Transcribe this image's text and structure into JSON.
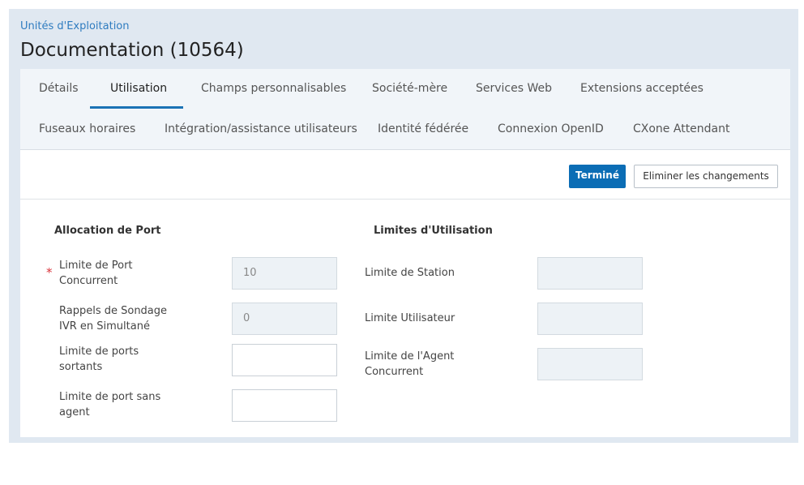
{
  "breadcrumb": "Unités d'Exploitation",
  "title": "Documentation (10564)",
  "tabs": {
    "details": "Détails",
    "usage": "Utilisation",
    "custom_fields": "Champs personnalisables",
    "parent_company": "Société-mère",
    "web_services": "Services Web",
    "accepted_extensions": "Extensions acceptées",
    "time_zones": "Fuseaux horaires",
    "integration": "Intégration/assistance utilisateurs",
    "federated_identity": "Identité fédérée",
    "openid": "Connexion OpenID",
    "cxone_attendant": "CXone Attendant",
    "active": "usage"
  },
  "actions": {
    "done": "Terminé",
    "discard": "Eliminer les changements"
  },
  "port_allocation": {
    "title": "Allocation de Port",
    "concurrent_port_limit": {
      "label_line1": "Limite de Port",
      "label_line2": "Concurrent",
      "value": "10",
      "required": "*"
    },
    "ivr_callbacks": {
      "label_line1": "Rappels de Sondage",
      "label_line2": "IVR en Simultané",
      "value": "0"
    },
    "outbound_ports": {
      "label_line1": "Limite de ports",
      "label_line2": "sortants",
      "value": ""
    },
    "agentless_ports": {
      "label_line1": "Limite de port sans",
      "label_line2": "agent",
      "value": ""
    }
  },
  "usage_limits": {
    "title": "Limites d'Utilisation",
    "station_limit": {
      "label": "Limite de Station",
      "value": ""
    },
    "user_limit": {
      "label": "Limite Utilisateur",
      "value": ""
    },
    "concurrent_agent_limit": {
      "label_line1": "Limite de l'Agent",
      "label_line2": "Concurrent",
      "value": ""
    }
  },
  "colors": {
    "accent": "#0b6db5",
    "link": "#2f7cc0",
    "required": "#d9343b",
    "frame": "#e0e8f1"
  }
}
